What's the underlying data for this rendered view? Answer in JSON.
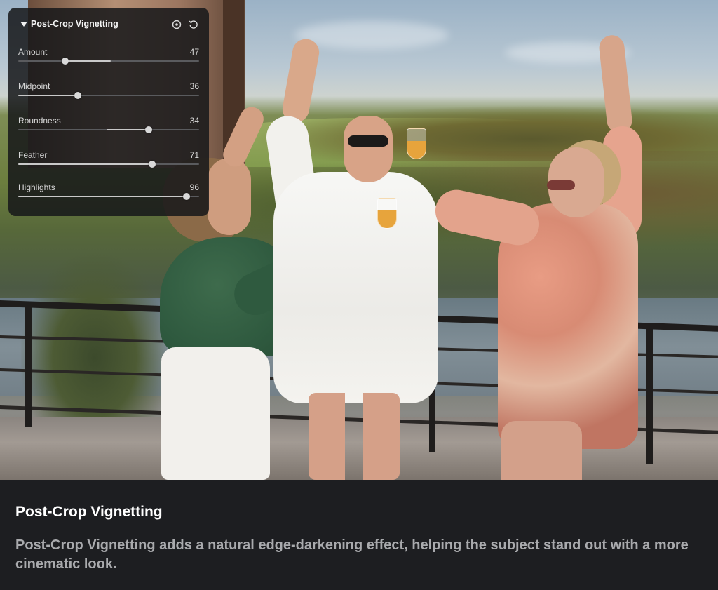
{
  "panel": {
    "title": "Post-Crop Vignetting",
    "icons": {
      "collapse": "triangle-down-icon",
      "visibility": "eye-icon",
      "reset": "reset-icon"
    },
    "sliders": [
      {
        "label": "Amount",
        "value": "47",
        "level": 0.26,
        "fill_from": 0.26,
        "fill_to": 0.51
      },
      {
        "label": "Midpoint",
        "value": "36",
        "level": 0.33,
        "fill_from": 0.0,
        "fill_to": 0.33
      },
      {
        "label": "Roundness",
        "value": "34",
        "level": 0.72,
        "fill_from": 0.49,
        "fill_to": 0.72
      },
      {
        "label": "Feather",
        "value": "71",
        "level": 0.74,
        "fill_from": 0.0,
        "fill_to": 0.74
      },
      {
        "label": "Highlights",
        "value": "96",
        "level": 0.93,
        "fill_from": 0.0,
        "fill_to": 0.93
      }
    ]
  },
  "caption": {
    "title": "Post-Crop Vignetting",
    "description": "Post-Crop Vignetting adds a natural edge-darkening effect, helping the subject stand out with a more cinematic look."
  },
  "colors": {
    "panel_bg": "#16171a",
    "caption_bg": "#1d1e21",
    "caption_text": "#a9aaad"
  }
}
